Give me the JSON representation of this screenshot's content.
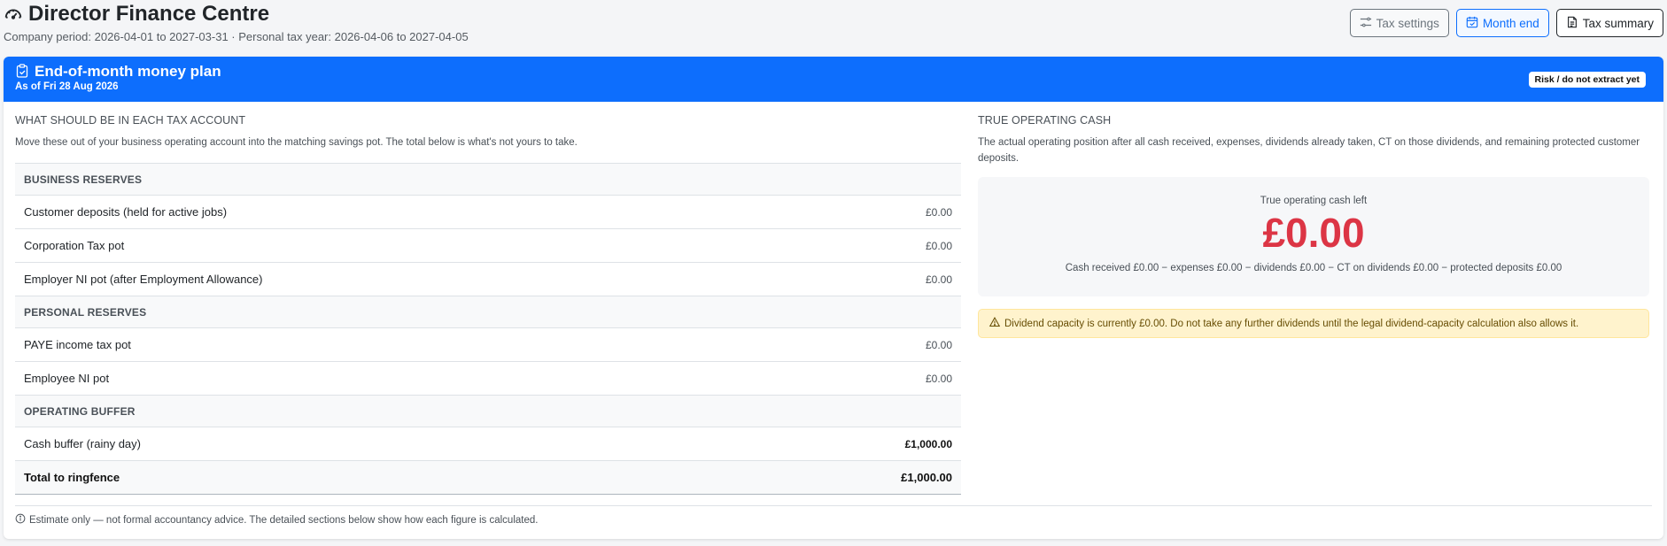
{
  "header": {
    "title": "Director Finance Centre",
    "title_icon": "speedometer-icon",
    "period_text": "Company period: 2026-04-01 to 2027-03-31 · Personal tax year: 2026-04-06 to 2027-04-05",
    "buttons": {
      "tax_settings": "Tax settings",
      "month_end": "Month end",
      "tax_summary": "Tax summary"
    }
  },
  "card": {
    "title": "End-of-month money plan",
    "subtitle": "As of Fri 28 Aug 2026",
    "badge": "Risk / do not extract yet",
    "accent_color": "#0d6efd"
  },
  "left": {
    "heading": "WHAT SHOULD BE IN EACH TAX ACCOUNT",
    "description": "Move these out of your business operating account into the matching savings pot. The total below is what's not yours to take.",
    "groups": [
      {
        "title": "BUSINESS RESERVES",
        "items": [
          {
            "label": "Customer deposits (held for active jobs)",
            "amount": "£0.00"
          },
          {
            "label": "Corporation Tax pot",
            "amount": "£0.00"
          },
          {
            "label": "Employer NI pot (after Employment Allowance)",
            "amount": "£0.00"
          }
        ]
      },
      {
        "title": "PERSONAL RESERVES",
        "items": [
          {
            "label": "PAYE income tax pot",
            "amount": "£0.00"
          },
          {
            "label": "Employee NI pot",
            "amount": "£0.00"
          }
        ]
      },
      {
        "title": "OPERATING BUFFER",
        "items": [
          {
            "label": "Cash buffer (rainy day)",
            "amount": "£1,000.00"
          }
        ]
      }
    ],
    "total": {
      "label": "Total to ringfence",
      "amount": "£1,000.00"
    }
  },
  "right": {
    "heading": "TRUE OPERATING CASH",
    "description": "The actual operating position after all cash received, expenses, dividends already taken, CT on those dividends, and remaining protected customer deposits.",
    "cash_label": "True operating cash left",
    "cash_value": "£0.00",
    "cash_value_color": "#dc3545",
    "formula": "Cash received £0.00 − expenses £0.00 − dividends £0.00 − CT on dividends £0.00 − protected deposits £0.00",
    "warning": "Dividend capacity is currently £0.00. Do not take any further dividends until the legal dividend-capacity calculation also allows it."
  },
  "footer": {
    "note": "Estimate only — not formal accountancy advice. The detailed sections below show how each figure is calculated."
  }
}
